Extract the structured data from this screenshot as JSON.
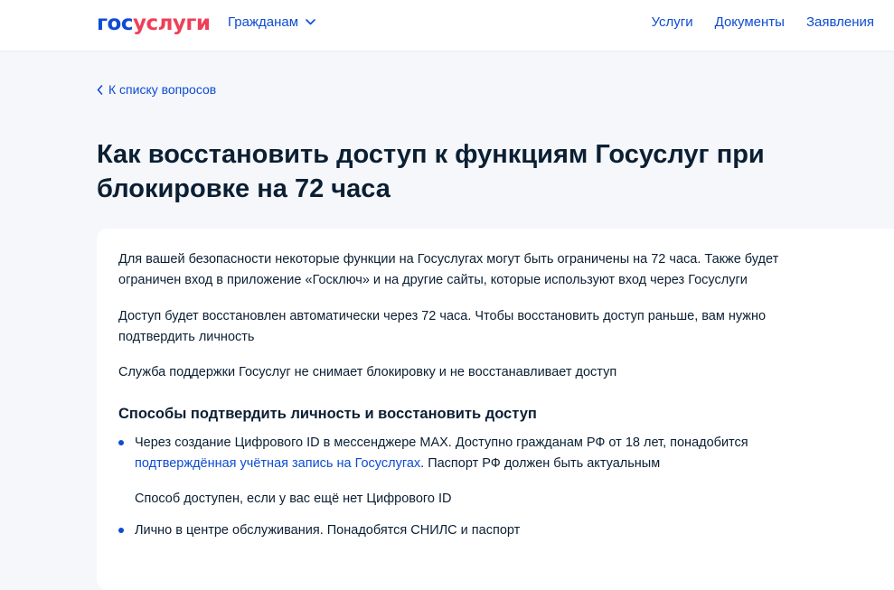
{
  "header": {
    "logo_part1": "гос",
    "logo_part2": "услуги",
    "audience_label": "Гражданам",
    "nav": [
      "Услуги",
      "Документы",
      "Заявления"
    ]
  },
  "back_link": "К списку вопросов",
  "title": "Как восстановить доступ к функциям Госуслуг при блокировке на 72 часа",
  "paragraphs": [
    "Для вашей безопасности некоторые функции на Госуслугах могут быть ограничены на 72 часа. Также будет ограничен вход в приложение «Госключ» и на другие сайты, которые используют вход через Госуслуги",
    "Доступ будет восстановлен автоматически через 72 часа. Чтобы восстановить доступ раньше, вам нужно подтвердить личность",
    "Служба поддержки Госуслуг не снимает блокировку и не восстанавливает доступ"
  ],
  "ways": {
    "heading": "Способы подтвердить личность и восстановить доступ",
    "item1_text1": "Через создание Цифрового ID в мессенджере MAX. Доступно гражданам РФ от 18 лет, понадобится ",
    "item1_link": "подтверждённая учётная запись на Госуслугах",
    "item1_text2": ". Паспорт РФ должен быть актуальным",
    "item1_note": "Способ доступен, если у вас ещё нет Цифрового ID",
    "item2": "Лично в центре обслуживания. Понадобятся СНИЛС и паспорт"
  },
  "colors": {
    "brand_blue": "#0d4cd3",
    "brand_red": "#ee3f58",
    "text": "#0b1f33",
    "background": "#f5f7fa"
  }
}
